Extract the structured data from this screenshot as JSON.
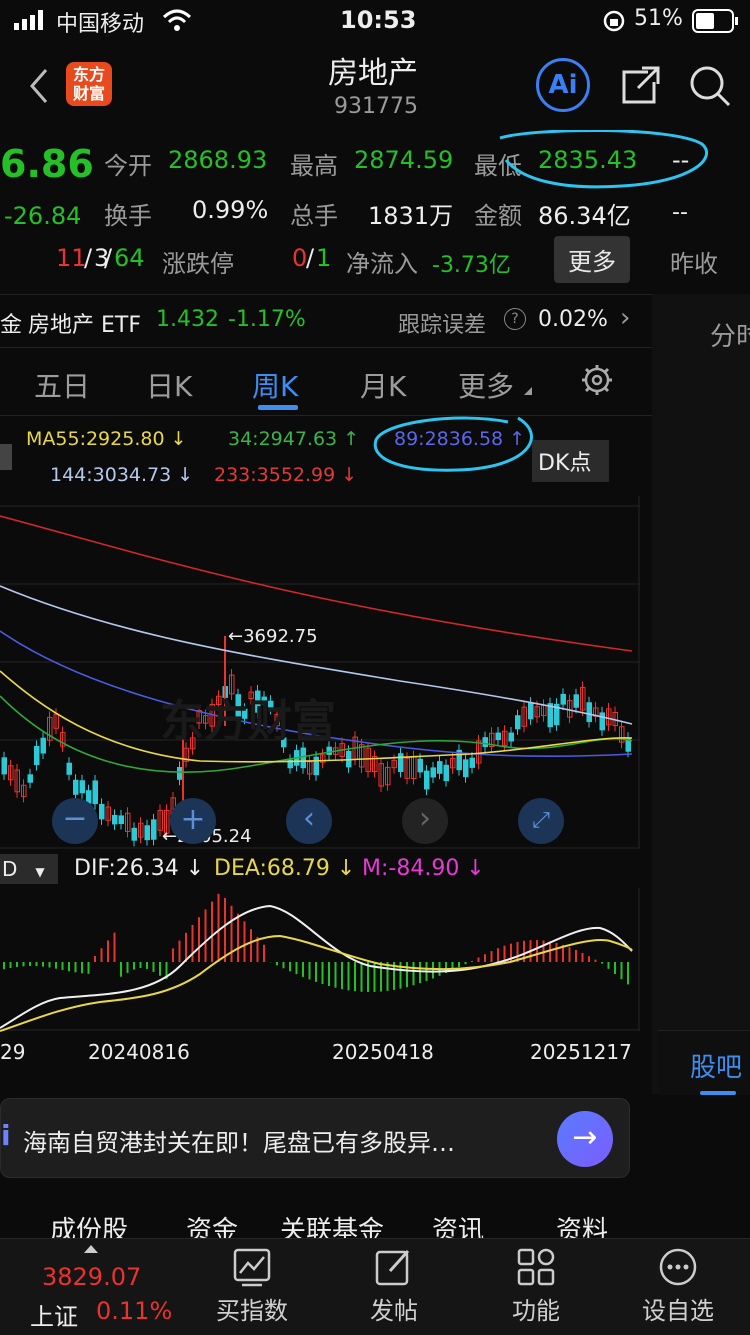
{
  "status": {
    "carrier": "中国移动",
    "time": "10:53",
    "battery": "51%"
  },
  "header": {
    "logo_line1": "东方",
    "logo_line2": "财富",
    "title": "房地产",
    "code": "931775",
    "ai_label": "Ai"
  },
  "quote": {
    "price": "6.86",
    "change": "-26.84",
    "open_label": "今开",
    "open": "2868.93",
    "high_label": "最高",
    "high": "2874.59",
    "low_label": "最低",
    "low": "2835.43",
    "dash1": "--",
    "turnover_label": "换手",
    "turnover": "0.99%",
    "volume_label": "总手",
    "volume": "1831万",
    "amount_label": "金额",
    "amount": "86.34亿",
    "dash2": "--",
    "ud_up": "11",
    "ud_sep1": "/",
    "ud_flat": "3",
    "ud_sep2": "/",
    "ud_down": "64",
    "limit_label": "涨跌停",
    "limit_up": "0",
    "limit_sep": "/",
    "limit_down": "1",
    "netflow_label": "净流入",
    "netflow": "-3.73亿",
    "more_button": "更多",
    "prev_close_label": "昨收"
  },
  "etf": {
    "prefix": "金",
    "name": "房地产 ETF",
    "price": "1.432",
    "pct": "-1.17%",
    "err_label": "跟踪误差",
    "err": "0.02%"
  },
  "right_panel": {
    "fenshi": "分时",
    "guba": "股吧"
  },
  "tabs": [
    "五日",
    "日K",
    "周K",
    "月K",
    "更多"
  ],
  "active_tab": "周K",
  "ma": {
    "ma55": "MA55:2925.80 ↓",
    "ma34": "34:2947.63 ↑",
    "ma89": "89:2836.58 ↑",
    "ma144": "144:3034.73 ↓",
    "ma233": "233:3552.99 ↓",
    "dk": "DK点"
  },
  "annotations": {
    "high": "←3692.75",
    "low": "←2205.24"
  },
  "macd": {
    "dif": "DIF:26.34 ↓",
    "dea": "DEA:68.79 ↓",
    "m": "M:-84.90 ↓",
    "selector": "D"
  },
  "dates": [
    "29",
    "20240816",
    "20250418",
    "20251217"
  ],
  "news": {
    "text": "海南自贸港封关在即！尾盘已有多股异…"
  },
  "subtabs": [
    "成份股",
    "资金",
    "关联基金",
    "资讯",
    "资料"
  ],
  "bottom": {
    "index_value": "3829.07",
    "index_name": "上证",
    "index_pct": "0.11%",
    "items": [
      "买指数",
      "发帖",
      "功能",
      "设自选"
    ]
  },
  "chart_data": {
    "type": "candlestick",
    "title": "",
    "timeframe": "周K",
    "annotated_high": 3692.75,
    "annotated_low": 2205.24,
    "x_ticks": [
      "20240816",
      "20250418",
      "20251217"
    ],
    "ma_values": {
      "MA55": 2925.8,
      "MA34": 2947.63,
      "MA89": 2836.58,
      "MA144": 3034.73,
      "MA233": 3552.99
    },
    "macd": {
      "DIF": 26.34,
      "DEA": 68.79,
      "M": -84.9
    }
  }
}
